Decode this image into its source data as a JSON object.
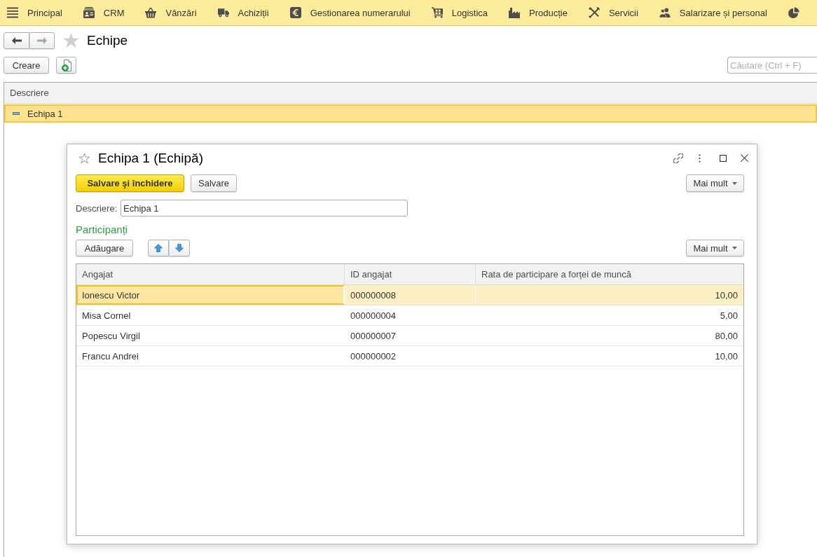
{
  "menu_bar": {
    "sections": [
      "Principal",
      "CRM",
      "Vânzări",
      "Achiziții",
      "Gestionarea numerarului",
      "Logistica",
      "Producție",
      "Servicii",
      "Salarizare și personal"
    ],
    "cut_off_section": true
  },
  "navigation": {
    "back_enabled": true,
    "forward_enabled": false
  },
  "page": {
    "title": "Echipe",
    "favorite": false
  },
  "toolbar": {
    "create_button": "Creare",
    "search": {
      "placeholder": "Căutare (Ctrl + F)"
    }
  },
  "list": {
    "columns": [
      "Descriere"
    ],
    "rows": [
      {
        "description": "Echipa 1",
        "selected": true
      }
    ]
  },
  "dialog": {
    "title": "Echipa 1 (Echipă)",
    "favorite": false,
    "buttons": [
      {
        "label": "Salvare şi închidere",
        "kind": "primary"
      },
      {
        "label": "Salvare",
        "kind": "default"
      }
    ],
    "more_button": "Mai mult",
    "fields": [
      {
        "label": "Descriere:",
        "value": "Echipa 1"
      }
    ],
    "section_title": "Participanți",
    "add_button": "Adăugare",
    "table_more_button": "Mai mult",
    "table": {
      "columns": [
        "Angajat",
        "ID angajat",
        "Rata de participare a forței de muncă"
      ],
      "rows": [
        {
          "employee": "Ionescu Victor",
          "employee_id": "000000008",
          "rate": "10,00",
          "selected": true
        },
        {
          "employee": "Misa Cornel",
          "employee_id": "000000004",
          "rate": "5,00",
          "selected": false
        },
        {
          "employee": "Popescu Virgil",
          "employee_id": "000000007",
          "rate": "80,00",
          "selected": false
        },
        {
          "employee": "Francu Andrei",
          "employee_id": "000000002",
          "rate": "10,00",
          "selected": false
        }
      ]
    }
  }
}
